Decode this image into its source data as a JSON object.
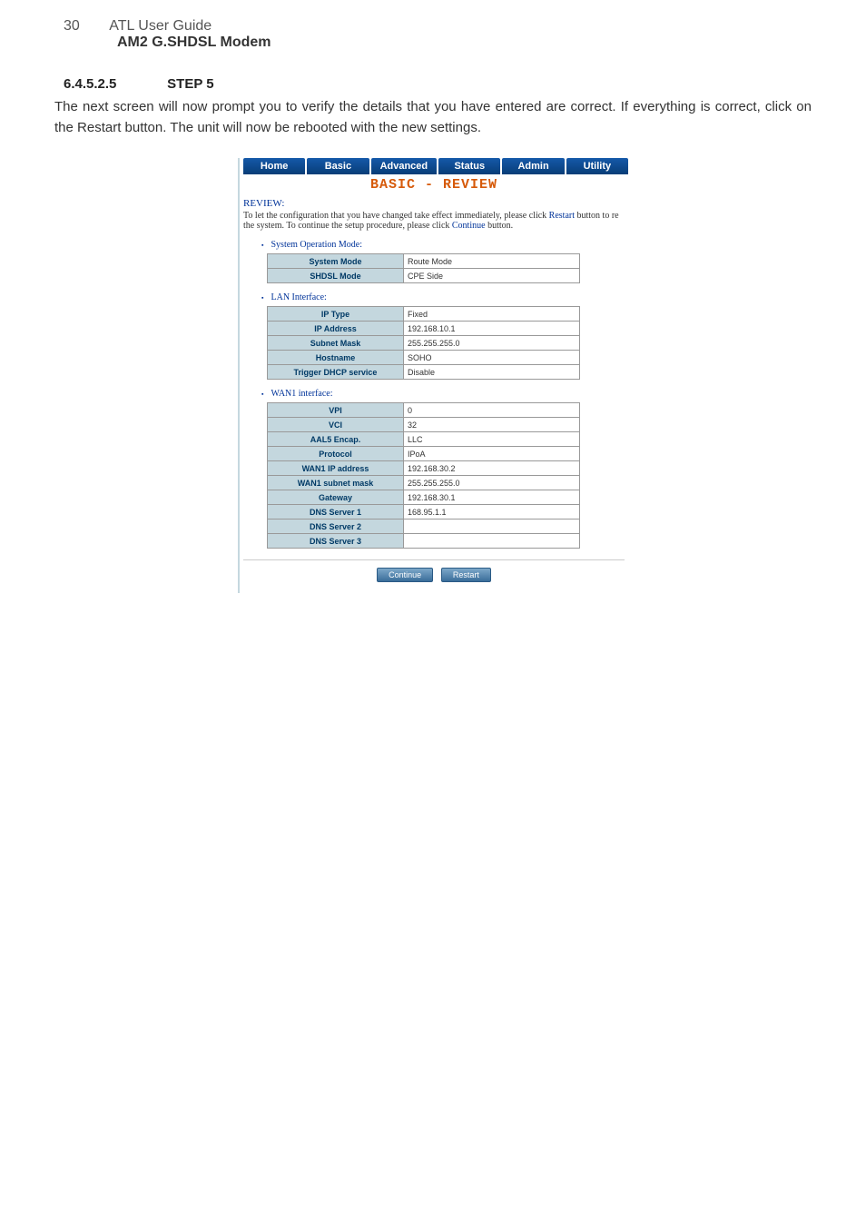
{
  "header": {
    "page_number": "30",
    "guide": "ATL User Guide",
    "model": "AM2 G.SHDSL Modem"
  },
  "section": {
    "number": "6.4.5.2.5",
    "title": "STEP 5",
    "body": "The next screen will now prompt you to verify the details that you have entered are correct. If everything is correct, click on the Restart button. The unit will now be rebooted with the new settings."
  },
  "nav": {
    "tabs": [
      "Home",
      "Basic",
      "Advanced",
      "Status",
      "Admin",
      "Utility"
    ]
  },
  "ui": {
    "page_title": "BASIC - REVIEW",
    "review_heading": "REVIEW:",
    "review_text_1": "To let the configuration that you have changed take effect immediately, please click ",
    "review_restart": "Restart",
    "review_text_2": " button to re the system. To continue the setup procedure, please click ",
    "review_continue": "Continue",
    "review_text_3": " button."
  },
  "tables": {
    "system_heading": "System Operation Mode:",
    "system": [
      {
        "label": "System Mode",
        "value": "Route Mode"
      },
      {
        "label": "SHDSL Mode",
        "value": "CPE Side"
      }
    ],
    "lan_heading": "LAN Interface:",
    "lan": [
      {
        "label": "IP Type",
        "value": "Fixed"
      },
      {
        "label": "IP Address",
        "value": "192.168.10.1"
      },
      {
        "label": "Subnet Mask",
        "value": "255.255.255.0"
      },
      {
        "label": "Hostname",
        "value": "SOHO"
      },
      {
        "label": "Trigger DHCP service",
        "value": "Disable"
      }
    ],
    "wan_heading": "WAN1 interface:",
    "wan": [
      {
        "label": "VPI",
        "value": "0"
      },
      {
        "label": "VCI",
        "value": "32"
      },
      {
        "label": "AAL5 Encap.",
        "value": "LLC"
      },
      {
        "label": "Protocol",
        "value": "IPoA"
      },
      {
        "label": "WAN1 IP address",
        "value": "192.168.30.2"
      },
      {
        "label": "WAN1 subnet mask",
        "value": "255.255.255.0"
      },
      {
        "label": "Gateway",
        "value": "192.168.30.1"
      },
      {
        "label": "DNS Server 1",
        "value": "168.95.1.1"
      },
      {
        "label": "DNS Server 2",
        "value": ""
      },
      {
        "label": "DNS Server 3",
        "value": ""
      }
    ]
  },
  "buttons": {
    "continue": "Continue",
    "restart": "Restart"
  }
}
